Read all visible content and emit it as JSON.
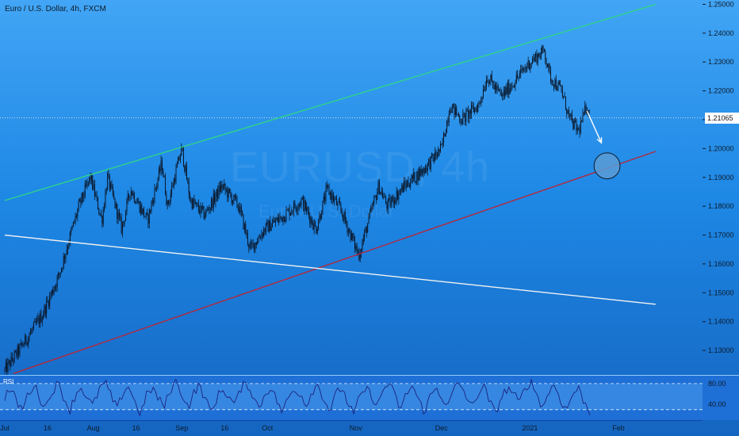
{
  "header": {
    "title": "Euro / U.S. Dollar, 4h, FXCM"
  },
  "watermark": {
    "symbol": "EURUSD, 4h",
    "description": "Euro / U.S. Dollar"
  },
  "current_price_label": "1.21065",
  "rsi_label": "RSI",
  "colors": {
    "background_top": "#42a5f5",
    "background_bottom": "#1565c0",
    "candles": "#0a1628",
    "upper_channel": "#2fd38a",
    "lower_channel": "#b4283c",
    "horizontal_trend": "#f2f2f2",
    "projection_arrow": "#ffffff",
    "target_circle": "#5b9bd5",
    "rsi_line": "#1a237e",
    "rsi_panel": "#1e6fd6"
  },
  "chart_data": [
    {
      "type": "candlestick",
      "title": "Euro / U.S. Dollar, 4h, FXCM",
      "y_axis": {
        "ticks": [
          "1.25000",
          "1.24000",
          "1.23000",
          "1.22000",
          "1.21000",
          "1.20000",
          "1.19000",
          "1.18000",
          "1.17000",
          "1.16000",
          "1.15000",
          "1.14000",
          "1.13000"
        ],
        "ylim": [
          1.1215,
          1.2515
        ],
        "side": "right"
      },
      "x_axis": {
        "ticks": [
          "Jul",
          "16",
          "Aug",
          "16",
          "Sep",
          "16",
          "Oct",
          "Nov",
          "Dec",
          "2021",
          "Feb"
        ]
      },
      "price_path": [
        [
          "2020-07-01",
          1.123
        ],
        [
          "2020-07-08",
          1.133
        ],
        [
          "2020-07-14",
          1.142
        ],
        [
          "2020-07-20",
          1.156
        ],
        [
          "2020-07-24",
          1.17
        ],
        [
          "2020-07-27",
          1.18
        ],
        [
          "2020-07-31",
          1.19
        ],
        [
          "2020-08-04",
          1.175
        ],
        [
          "2020-08-06",
          1.19
        ],
        [
          "2020-08-11",
          1.172
        ],
        [
          "2020-08-14",
          1.186
        ],
        [
          "2020-08-20",
          1.175
        ],
        [
          "2020-08-25",
          1.195
        ],
        [
          "2020-08-27",
          1.18
        ],
        [
          "2020-09-01",
          1.2
        ],
        [
          "2020-09-04",
          1.182
        ],
        [
          "2020-09-09",
          1.177
        ],
        [
          "2020-09-15",
          1.187
        ],
        [
          "2020-09-21",
          1.18
        ],
        [
          "2020-09-25",
          1.165
        ],
        [
          "2020-09-30",
          1.172
        ],
        [
          "2020-10-07",
          1.177
        ],
        [
          "2020-10-13",
          1.182
        ],
        [
          "2020-10-18",
          1.172
        ],
        [
          "2020-10-22",
          1.186
        ],
        [
          "2020-10-27",
          1.178
        ],
        [
          "2020-11-02",
          1.163
        ],
        [
          "2020-11-04",
          1.17
        ],
        [
          "2020-11-09",
          1.187
        ],
        [
          "2020-11-12",
          1.18
        ],
        [
          "2020-11-18",
          1.187
        ],
        [
          "2020-11-25",
          1.193
        ],
        [
          "2020-12-01",
          1.2
        ],
        [
          "2020-12-04",
          1.215
        ],
        [
          "2020-12-08",
          1.21
        ],
        [
          "2020-12-14",
          1.215
        ],
        [
          "2020-12-17",
          1.225
        ],
        [
          "2020-12-22",
          1.218
        ],
        [
          "2020-12-28",
          1.225
        ],
        [
          "2021-01-01",
          1.23
        ],
        [
          "2021-01-06",
          1.234
        ],
        [
          "2021-01-08",
          1.225
        ],
        [
          "2021-01-12",
          1.22
        ],
        [
          "2021-01-15",
          1.21
        ],
        [
          "2021-01-18",
          1.206
        ],
        [
          "2021-01-21",
          1.215
        ],
        [
          "2021-01-22",
          1.211
        ]
      ],
      "current_price": 1.21065,
      "annotations": [
        {
          "type": "trendline",
          "name": "upper-channel",
          "from": [
            "2020-07-01",
            1.182
          ],
          "to": [
            "2021-02-14",
            1.25
          ]
        },
        {
          "type": "trendline",
          "name": "lower-channel",
          "from": [
            "2020-07-04",
            1.122
          ],
          "to": [
            "2021-02-14",
            1.199
          ]
        },
        {
          "type": "trendline",
          "name": "horizontal-trend",
          "from": [
            "2020-07-01",
            1.17
          ],
          "to": [
            "2021-02-14",
            1.146
          ]
        },
        {
          "type": "arrow",
          "name": "projection-arrow",
          "from": [
            "2021-01-21",
            1.213
          ],
          "to": [
            "2021-01-26",
            1.202
          ]
        },
        {
          "type": "circle",
          "name": "target-circle",
          "center": [
            "2021-01-28",
            1.194
          ],
          "value_radius": 0.0045
        }
      ]
    },
    {
      "type": "line",
      "title": "RSI",
      "y_axis": {
        "ticks": [
          "80.00",
          "40.00"
        ],
        "ylim": [
          10,
          95
        ],
        "levels": [
          80,
          30
        ]
      },
      "rsi_points": [
        55,
        70,
        45,
        30,
        62,
        78,
        50,
        35,
        66,
        80,
        54,
        28,
        60,
        74,
        48,
        38,
        70,
        82,
        56,
        30,
        64,
        76,
        44,
        22,
        58,
        72,
        50,
        36,
        68,
        84,
        60,
        34,
        62,
        78,
        46,
        26,
        56,
        70,
        52,
        40,
        72,
        80,
        58,
        32,
        60,
        74,
        48,
        24,
        54,
        68,
        62,
        38,
        66,
        78,
        50,
        28,
        58,
        74,
        44,
        20,
        52,
        70,
        60,
        34,
        68,
        82,
        56,
        30,
        62,
        76,
        48,
        26,
        56,
        72,
        54,
        36,
        70,
        80,
        58,
        32,
        60,
        76,
        46,
        22,
        54,
        70,
        64,
        40,
        72,
        84,
        60,
        34,
        64,
        78,
        50,
        28,
        58,
        72,
        46,
        24
      ]
    }
  ]
}
